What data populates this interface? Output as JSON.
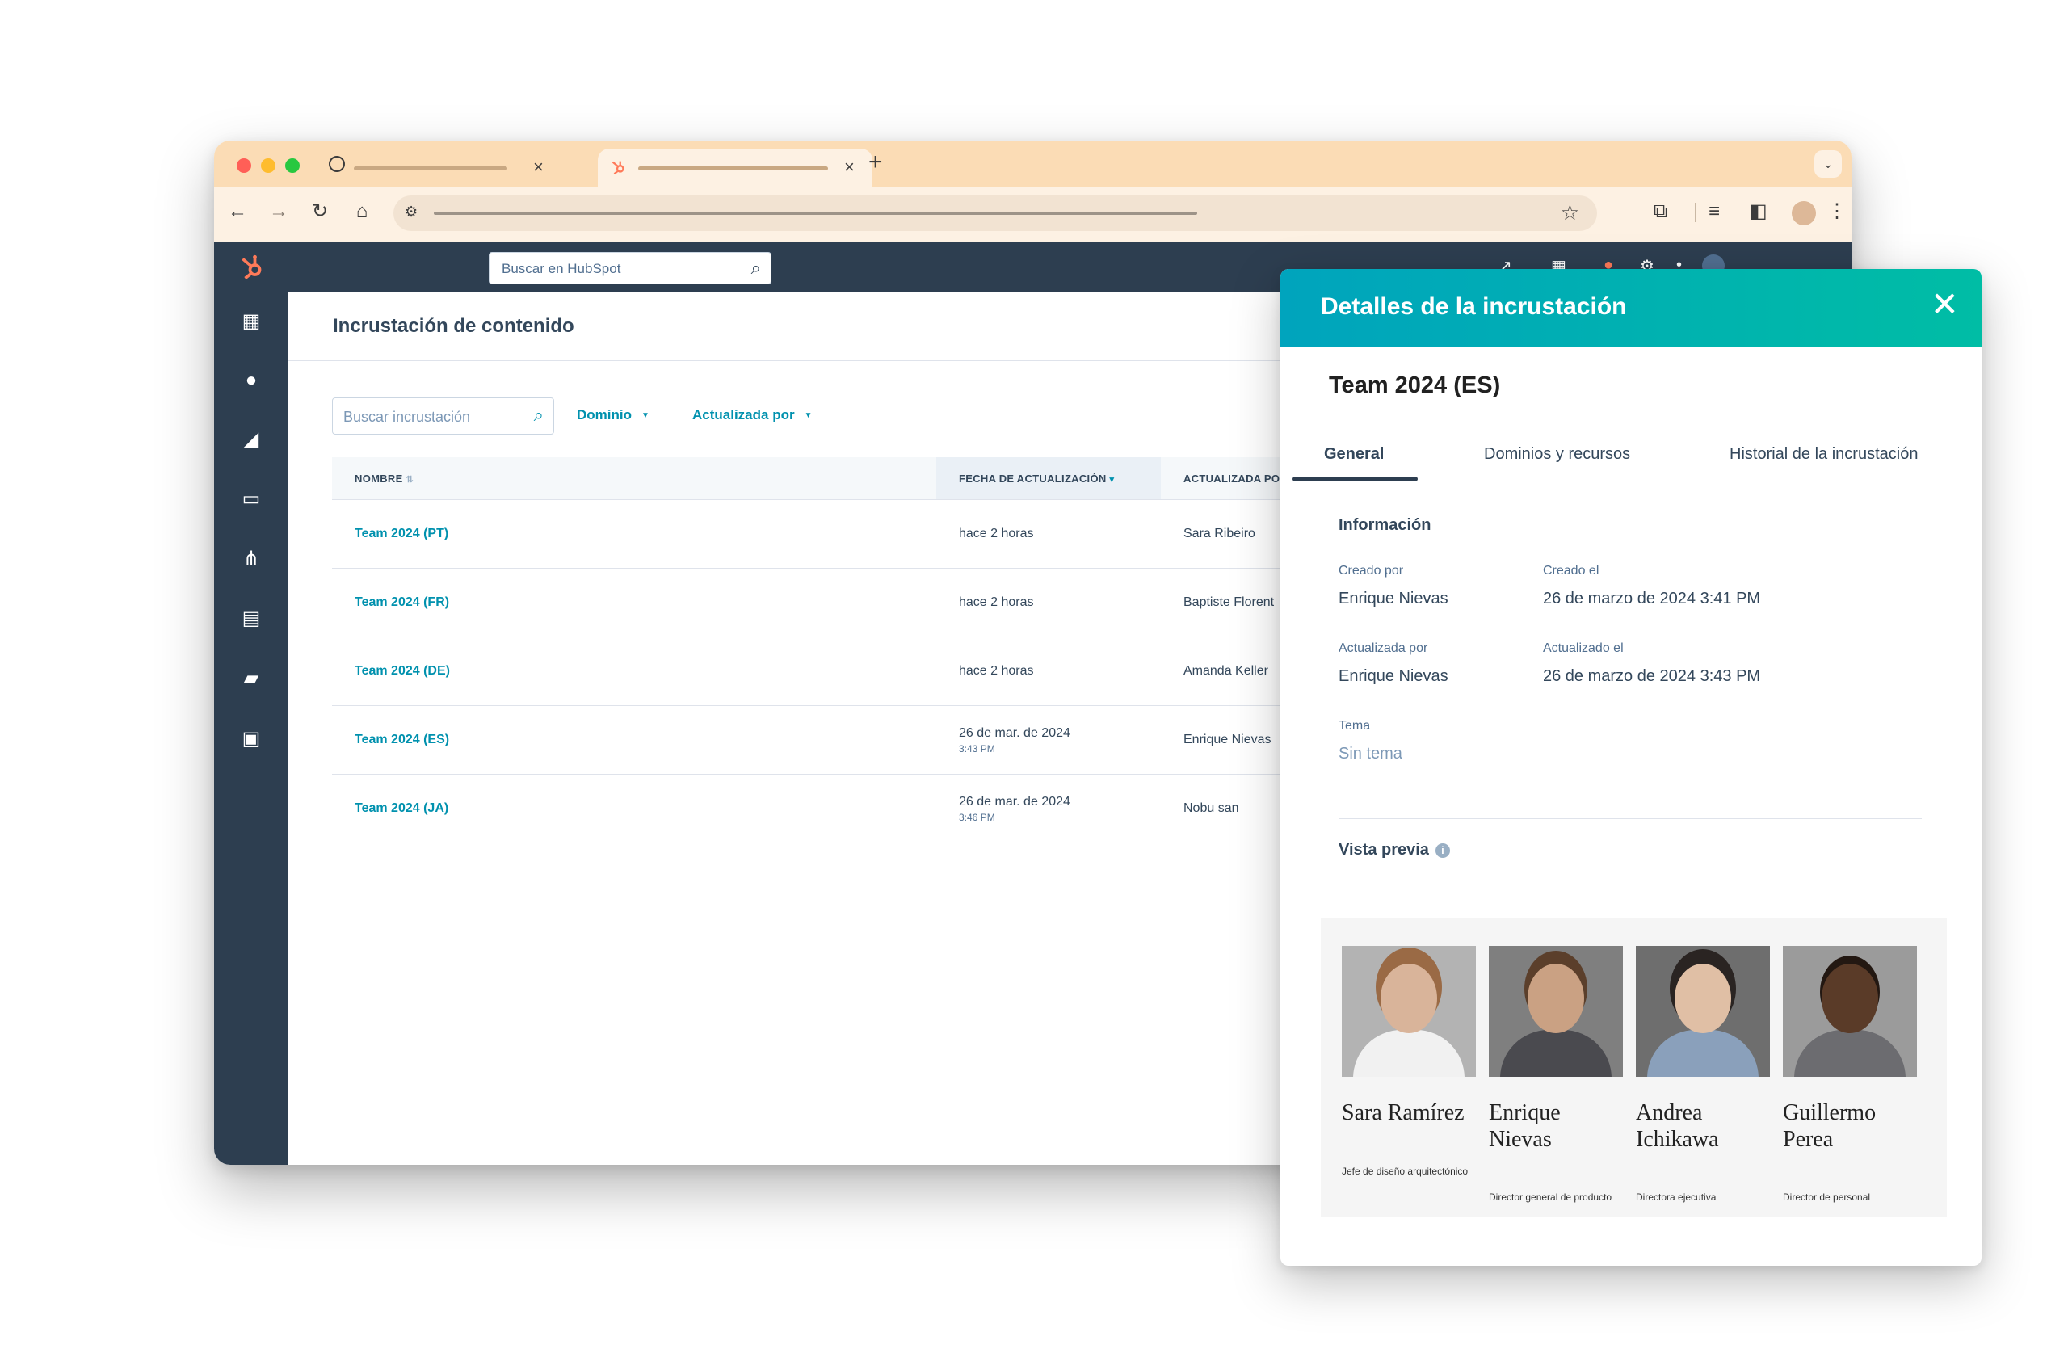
{
  "browser": {
    "tabs": [
      {
        "icon": "globe-icon",
        "close": "×"
      },
      {
        "icon": "hubspot-icon",
        "close": "×"
      }
    ],
    "new_tab": "+",
    "tab_menu": "⌄"
  },
  "hubspot": {
    "search_placeholder": "Buscar en HubSpot",
    "page_title": "Incrustación de contenido",
    "filters": {
      "search_placeholder": "Buscar incrustación",
      "domain": "Dominio",
      "updated_by": "Actualizada por"
    },
    "table": {
      "columns": [
        "NOMBRE",
        "FECHA DE ACTUALIZACIÓN",
        "ACTUALIZADA POR"
      ],
      "rows": [
        {
          "name": "Team 2024 (PT)",
          "date": "hace 2 horas",
          "time": "",
          "user": "Sara Ribeiro"
        },
        {
          "name": "Team 2024 (FR)",
          "date": "hace 2 horas",
          "time": "",
          "user": "Baptiste Florent"
        },
        {
          "name": "Team 2024 (DE)",
          "date": "hace 2 horas",
          "time": "",
          "user": "Amanda Keller"
        },
        {
          "name": "Team 2024 (ES)",
          "date": "26 de mar. de 2024",
          "time": "3:43 PM",
          "user": "Enrique Nievas"
        },
        {
          "name": "Team 2024 (JA)",
          "date": "26 de mar. de 2024",
          "time": "3:46 PM",
          "user": "Nobu san"
        }
      ]
    }
  },
  "panel": {
    "title": "Detalles de la incrustación",
    "record_name": "Team 2024 (ES)",
    "tabs": [
      "General",
      "Dominios y recursos",
      "Historial de la incrustación"
    ],
    "info_heading": "Información",
    "created_by_label": "Creado por",
    "created_by": "Enrique Nievas",
    "created_on_label": "Creado el",
    "created_on": "26 de marzo de 2024 3:41 PM",
    "updated_by_label": "Actualizada por",
    "updated_by": "Enrique Nievas",
    "updated_on_label": "Actualizado el",
    "updated_on": "26 de marzo de 2024 3:43 PM",
    "theme_label": "Tema",
    "theme_value": "Sin tema",
    "preview_heading": "Vista previa",
    "team": [
      {
        "name": "Sara Ramírez",
        "role": "Jefe de diseño arquitectónico"
      },
      {
        "name": "Enrique Nievas",
        "role": "Director general de producto"
      },
      {
        "name": "Andrea Ichikawa",
        "role": "Directora ejecutiva"
      },
      {
        "name": "Guillermo Perea",
        "role": "Director de personal"
      }
    ]
  },
  "colors": {
    "accent": "#0091ae",
    "nav": "#2d3e50",
    "panel_header_start": "#00a4bd",
    "panel_header_end": "#00bda5",
    "chrome_tabbar": "#fbdcb5"
  }
}
